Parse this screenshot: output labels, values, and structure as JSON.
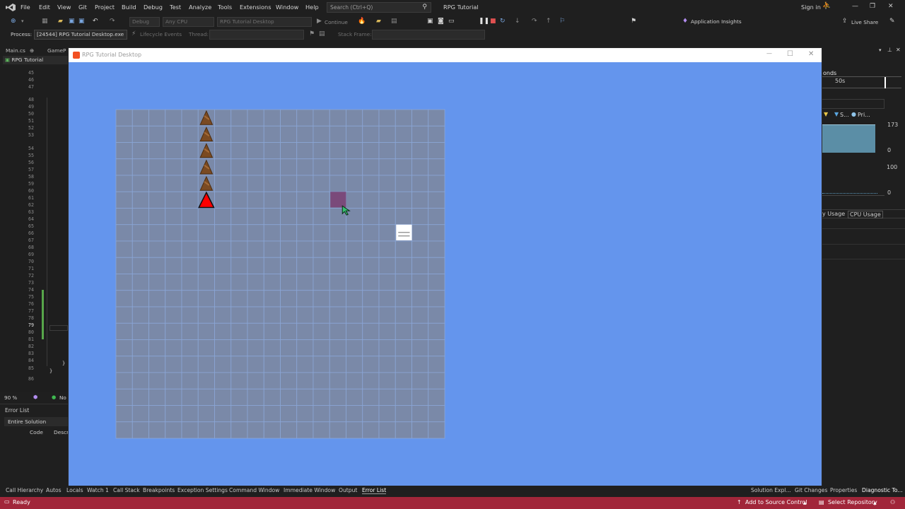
{
  "menu": {
    "items": [
      "File",
      "Edit",
      "View",
      "Git",
      "Project",
      "Build",
      "Debug",
      "Test",
      "Analyze",
      "Tools",
      "Extensions",
      "Window",
      "Help"
    ],
    "search_placeholder": "Search (Ctrl+Q)",
    "solution_name": "RPG Tutorial",
    "sign_in": "Sign in"
  },
  "toolbar": {
    "config": "Debug",
    "platform": "Any CPU",
    "startup_project": "RPG Tutorial Desktop",
    "continue": "Continue",
    "app_insights": "Application Insights",
    "live_share": "Live Share",
    "process_label": "Process:",
    "process_value": "[24544] RPG Tutorial Desktop.exe",
    "lifecycle": "Lifecycle Events",
    "thread_label": "Thread:",
    "stack_frame_label": "Stack Frame:"
  },
  "editor": {
    "tabs": [
      "Main.cs",
      "GameP"
    ],
    "tab_pin": "⊕",
    "nav_project": "RPG Tutorial",
    "line_numbers": [
      "45",
      "46",
      "47",
      "48",
      "49",
      "50",
      "51",
      "52",
      "53",
      "54",
      "55",
      "56",
      "57",
      "58",
      "59",
      "60",
      "61",
      "62",
      "63",
      "64",
      "65",
      "66",
      "67",
      "68",
      "69",
      "70",
      "71",
      "72",
      "73",
      "74",
      "75",
      "76",
      "77",
      "78",
      "79",
      "80",
      "81",
      "82",
      "83",
      "84",
      "85",
      "86"
    ],
    "current_line": "79",
    "code_glyphs": {
      "close_brace": "}",
      "close_brace_2": "}"
    },
    "zoom": "90 %",
    "issues": "No"
  },
  "error_list": {
    "title": "Error List",
    "scope": "Entire Solution",
    "col_code": "Code",
    "col_desc": "Descr"
  },
  "diagnostics": {
    "seconds_label": "onds",
    "timeline_50s": "50s",
    "legend_s": "S...",
    "legend_pri": "Pri...",
    "memory_max": "173",
    "memory_min": "0",
    "cpu_max": "100",
    "cpu_min": "0",
    "tab_memory": "y Usage",
    "tab_cpu": "CPU Usage"
  },
  "app_window": {
    "title": "RPG Tutorial Desktop",
    "minimize": "—",
    "maximize": "☐",
    "close": "✕"
  },
  "game": {
    "grid_cols": 20,
    "grid_rows": 20,
    "tile_fill": "#7a89a8",
    "background": "#6495ed",
    "enemies_column": 5,
    "enemy_rows": [
      0,
      1,
      2,
      3,
      4
    ],
    "player_tile": {
      "col": 5,
      "row": 5
    },
    "selected_tile": {
      "col": 13,
      "row": 5
    },
    "item_tile": {
      "col": 17,
      "row": 7
    }
  },
  "bottom_tabs": {
    "left": [
      "Call Hierarchy",
      "Autos",
      "Locals",
      "Watch 1",
      "Call Stack",
      "Breakpoints",
      "Exception Settings",
      "Command Window",
      "Immediate Window",
      "Output",
      "Error List"
    ],
    "right": [
      "Solution Expl...",
      "Git Changes",
      "Properties",
      "Diagnostic To..."
    ]
  },
  "status_bar": {
    "state": "Ready",
    "source_control": "Add to Source Control",
    "select_repo": "Select Repository"
  }
}
